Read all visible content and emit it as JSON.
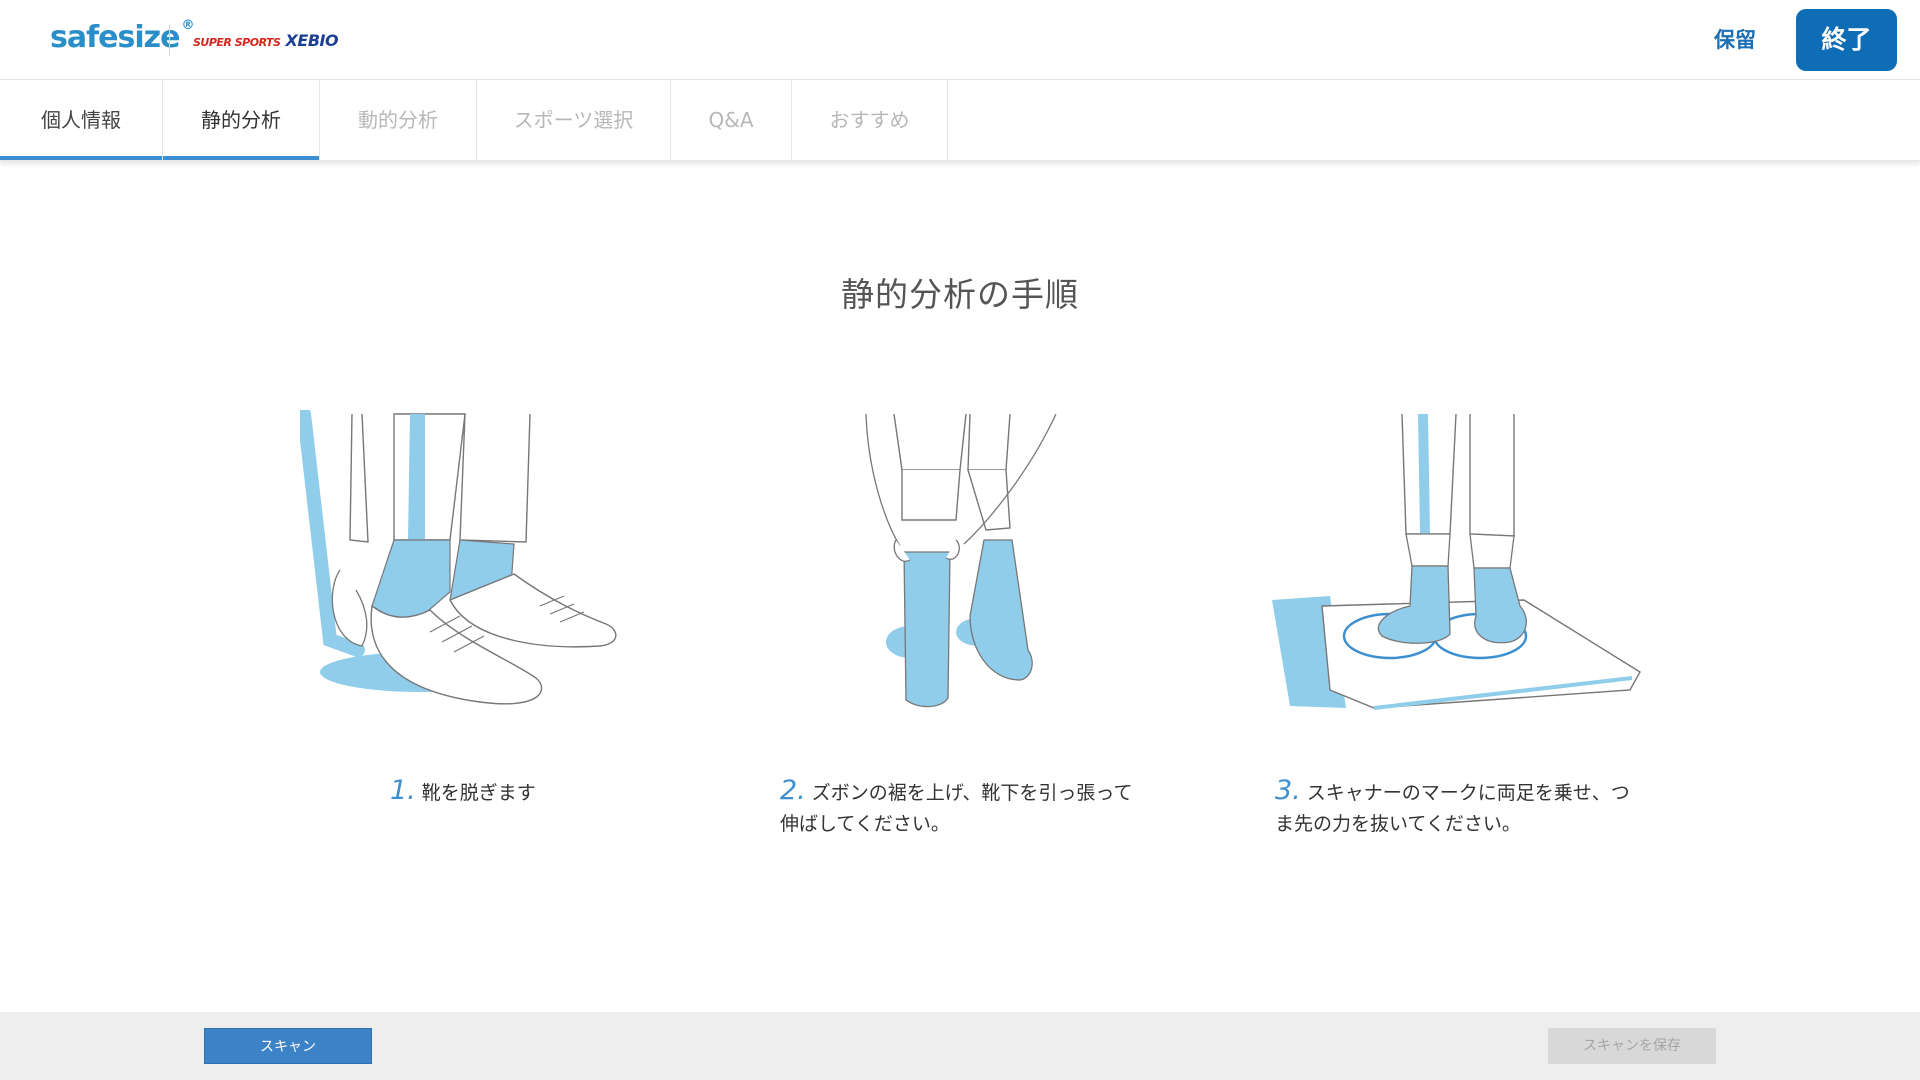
{
  "header": {
    "logo_brand": "safesize",
    "logo_brand_mark": "®",
    "partner_logo_prefix": "SUPER SPORTS",
    "partner_logo_name": "XEBIO",
    "hold_label": "保留",
    "finish_label": "終了"
  },
  "tabs": [
    {
      "label": "個人情報",
      "state": "done"
    },
    {
      "label": "静的分析",
      "state": "active"
    },
    {
      "label": "動的分析",
      "state": "disabled"
    },
    {
      "label": "スポーツ選択",
      "state": "disabled"
    },
    {
      "label": "Q&A",
      "state": "disabled"
    },
    {
      "label": "おすすめ",
      "state": "disabled"
    }
  ],
  "main": {
    "title": "静的分析の手順",
    "steps": [
      {
        "num": "1.",
        "text_line1": "靴を脱ぎます",
        "text_line2": "",
        "icon": "remove-shoes-illustration"
      },
      {
        "num": "2.",
        "text_line1": "ズボンの裾を上げ、靴下を引っ張って",
        "text_line2": "伸ばしてください。",
        "icon": "pull-socks-illustration"
      },
      {
        "num": "3.",
        "text_line1": "スキャナーのマークに両足を乗せ、つ",
        "text_line2": "ま先の力を抜いてください。",
        "icon": "stand-on-scanner-illustration"
      }
    ]
  },
  "footer": {
    "scan_label": "スキャン",
    "save_label": "スキャンを保存"
  },
  "colors": {
    "accent": "#0f6db5",
    "tab_indicator": "#3c8fd2",
    "illustration_blue": "#8fcdea"
  }
}
